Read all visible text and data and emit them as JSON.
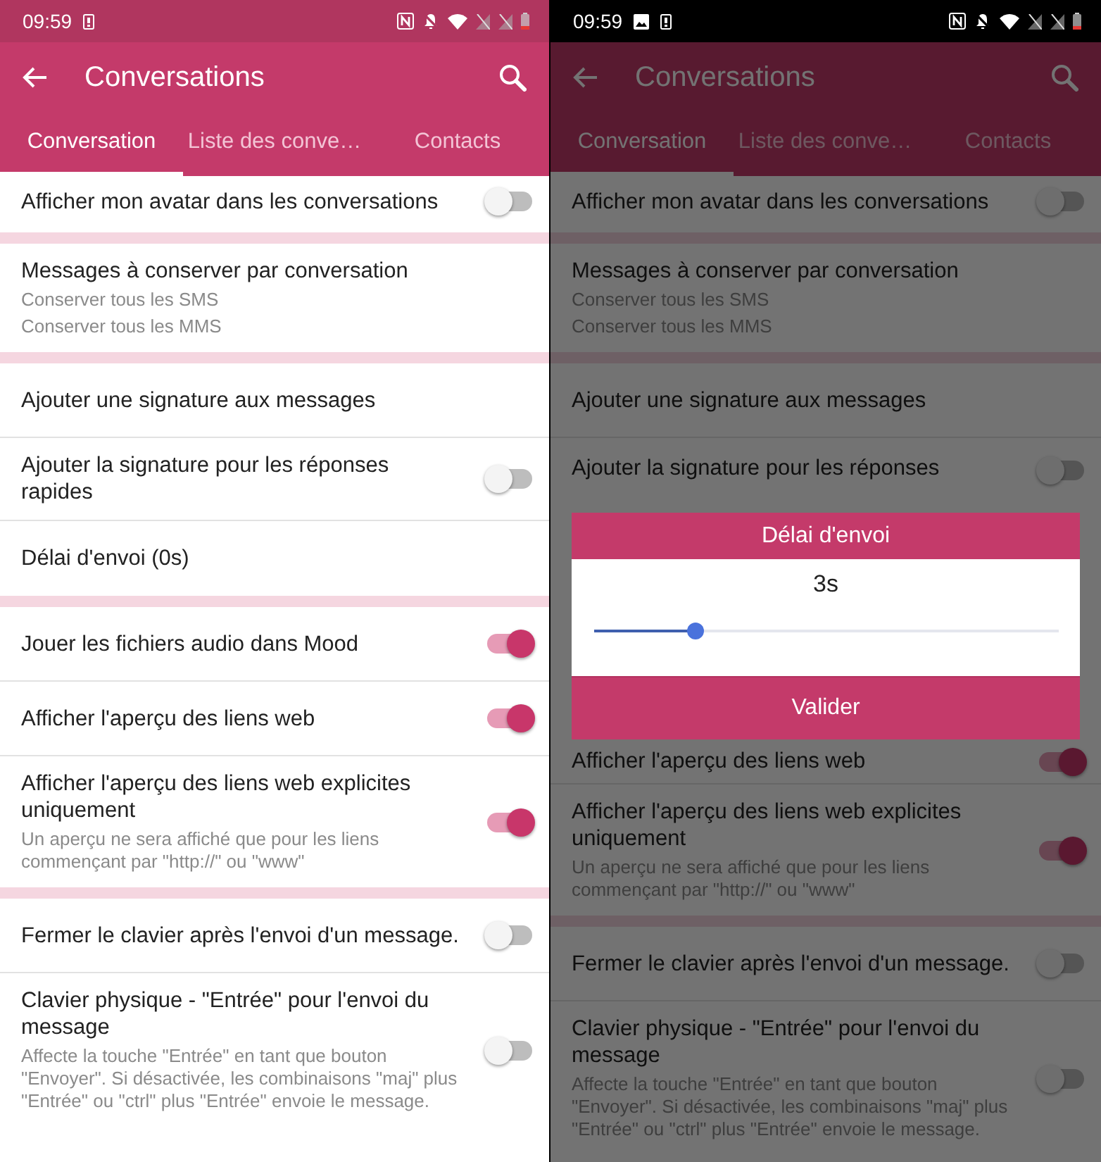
{
  "screens": [
    {
      "dimmed": false,
      "status_bar": {
        "time": "09:59",
        "notifications": [
          {
            "kind": "device"
          }
        ]
      },
      "toolbar": {
        "title": "Conversations"
      },
      "tabs": [
        {
          "label": "Conversation",
          "selected": true
        },
        {
          "label": "Liste des conve…",
          "selected": false
        },
        {
          "label": "Contacts",
          "selected": false
        }
      ],
      "groups_above": [
        {
          "items": [
            {
              "kind": "toggle",
              "title": "Afficher mon avatar dans les conversations",
              "on": false
            }
          ]
        },
        {
          "items": [
            {
              "kind": "text",
              "title": "Messages à conserver par conversation",
              "summary_lines": [
                "Conserver tous les SMS",
                "Conserver tous les MMS"
              ]
            }
          ]
        },
        {
          "items": [
            {
              "kind": "text",
              "title": "Ajouter une signature aux messages"
            },
            {
              "kind": "toggle",
              "title": "Ajouter la signature pour les réponses rapides",
              "on": false
            },
            {
              "kind": "text",
              "title": "Délai d'envoi (0s)"
            }
          ]
        },
        {
          "items": [
            {
              "kind": "toggle",
              "title": "Jouer les fichiers audio dans Mood",
              "on": true
            },
            {
              "kind": "toggle",
              "title": "Afficher l'aperçu des liens web",
              "on": true
            },
            {
              "kind": "toggle",
              "title": "Afficher l'aperçu des liens web explicites uniquement",
              "on": true,
              "summary_lines": [
                "Un aperçu ne sera affiché que pour les liens commençant par \"http://\" ou \"www\""
              ]
            }
          ]
        },
        {
          "items": [
            {
              "kind": "toggle",
              "title": "Fermer le clavier après l'envoi d'un message.",
              "on": false
            },
            {
              "kind": "toggle",
              "title": "Clavier physique - \"Entrée\" pour l'envoi du message",
              "on": false,
              "summary_lines": [
                "Affecte la touche \"Entrée\" en tant que bouton \"Envoyer\". Si désactivée, les combinaisons \"maj\" plus \"Entrée\" ou \"ctrl\" plus \"Entrée\" envoie le message."
              ]
            }
          ]
        }
      ]
    },
    {
      "dimmed": true,
      "status_bar": {
        "time": "09:59",
        "notifications": [
          {
            "kind": "image"
          },
          {
            "kind": "device"
          }
        ]
      },
      "toolbar": {
        "title": "Conversations"
      },
      "tabs": [
        {
          "label": "Conversation",
          "selected": true
        },
        {
          "label": "Liste des conve…",
          "selected": false
        },
        {
          "label": "Contacts",
          "selected": false
        }
      ],
      "groups_above": [
        {
          "items": [
            {
              "kind": "toggle",
              "title": "Afficher mon avatar dans les conversations",
              "on": false
            }
          ]
        },
        {
          "items": [
            {
              "kind": "text",
              "title": "Messages à conserver par conversation",
              "summary_lines": [
                "Conserver tous les SMS",
                "Conserver tous les MMS"
              ]
            }
          ]
        },
        {
          "items": [
            {
              "kind": "text",
              "title": "Ajouter une signature aux messages"
            },
            {
              "kind": "toggle",
              "title": "Ajouter la signature pour les réponses",
              "on": false
            }
          ]
        }
      ],
      "dialog": {
        "title": "Délai d'envoi",
        "value": "3s",
        "level": 0.22,
        "button": "Valider"
      },
      "groups_below": [
        {
          "items": [
            {
              "kind": "toggle",
              "title": "Afficher l'aperçu des liens web",
              "on": true
            },
            {
              "kind": "toggle",
              "title": "Afficher l'aperçu des liens web explicites uniquement",
              "on": true,
              "summary_lines": [
                "Un aperçu ne sera affiché que pour les liens commençant par \"http://\" ou \"www\""
              ]
            }
          ]
        },
        {
          "items": [
            {
              "kind": "toggle",
              "title": "Fermer le clavier après l'envoi d'un message.",
              "on": false
            },
            {
              "kind": "toggle",
              "title": "Clavier physique - \"Entrée\" pour l'envoi du message",
              "on": false,
              "summary_lines": [
                "Affecte la touche \"Entrée\" en tant que bouton \"Envoyer\". Si désactivée, les combinaisons \"maj\" plus \"Entrée\" ou \"ctrl\" plus \"Entrée\" envoie le message."
              ]
            }
          ]
        }
      ]
    }
  ]
}
